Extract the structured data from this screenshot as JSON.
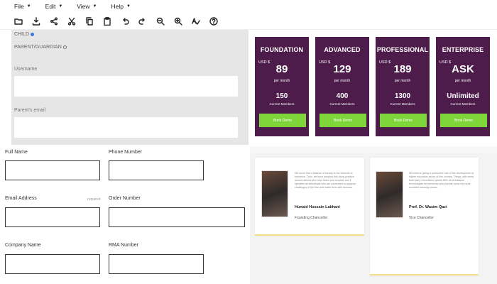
{
  "menu": [
    "File",
    "Edit",
    "View",
    "Help"
  ],
  "toolbar": [
    "folder-icon",
    "download-icon",
    "share-icon",
    "cut-icon",
    "copy-icon",
    "paste-icon",
    "undo-icon",
    "redo-icon",
    "zoom-out-icon",
    "zoom-in-icon",
    "spellcheck-icon",
    "help-icon"
  ],
  "signup": {
    "radio_child": "CHILD",
    "radio_parent": "PARENT/GUARDIAN",
    "username_label": "Username",
    "parent_email_label": "Parent's email"
  },
  "form": {
    "full_name": "Full Name",
    "phone_number": "Phone Number",
    "email_address": "Email Address",
    "required_hint": "required",
    "order_number": "Order Number",
    "company_name": "Company Name",
    "rma_number": "RMA Number"
  },
  "plans": [
    {
      "name": "FOUNDATION",
      "currency": "USD $",
      "price": "89",
      "per": "per month",
      "members": "150",
      "members_label": "Current Members",
      "button": "Book Demo"
    },
    {
      "name": "ADVANCED",
      "currency": "USD $",
      "price": "129",
      "per": "per month",
      "members": "400",
      "members_label": "Current Members",
      "button": "Book Demo"
    },
    {
      "name": "PROFESSIONAL",
      "currency": "USD $",
      "price": "189",
      "per": "per month",
      "members": "1300",
      "members_label": "Current Members",
      "button": "Book Demo"
    },
    {
      "name": "ENTERPRISE",
      "currency": "USD $",
      "price": "ASK",
      "per": "per month",
      "members": "Unlimited",
      "members_label": "Current Members",
      "button": "Book Demo"
    }
  ],
  "testimonials": [
    {
      "text": "We know that a balance of beauty is the bedrock of tomorrow. Thus, we have adopted this study practice around almost who have fallen and needed, and it operates all individuals who are connected to advance challenges of the fine and make them with success.",
      "name": "Hunaid Hussain Lakhani",
      "role": "Founding Chancellor"
    },
    {
      "text": "We believe giving a productive role of the development of higher education sector of this country. Things, with every fluid have Universities uphold 80% of all Advance technologies for tomorrow who provide some the more excellent learning means.",
      "name": "Prof. Dr. Wasim Qazi",
      "role": "Vice Chancellor"
    }
  ],
  "colors": {
    "plan_bg": "#4d1c4b",
    "plan_button": "#7fd63a",
    "card_accent": "#f4e08a"
  }
}
